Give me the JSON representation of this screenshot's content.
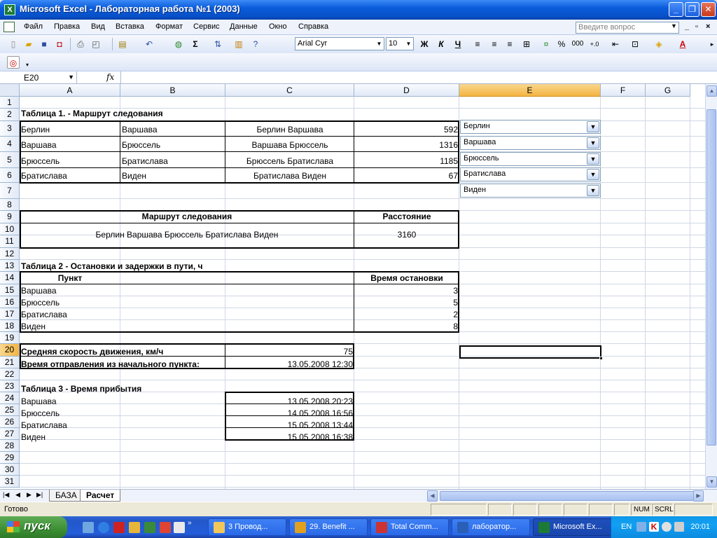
{
  "window": {
    "title": "Microsoft Excel - Лабораторная работа №1 (2003)"
  },
  "menu": {
    "items": [
      "Файл",
      "Правка",
      "Вид",
      "Вставка",
      "Формат",
      "Сервис",
      "Данные",
      "Окно",
      "Справка"
    ],
    "ask_placeholder": "Введите вопрос"
  },
  "toolbar": {
    "font": "Arial Cyr",
    "size": "10",
    "bold": "Ж",
    "italic": "К",
    "underline": "Ч",
    "percent": "%",
    "thousands": "000"
  },
  "formula_bar": {
    "name_box": "E20",
    "fx": "fx",
    "value": ""
  },
  "columns": [
    "A",
    "B",
    "C",
    "D",
    "E",
    "F",
    "G"
  ],
  "rows": [
    "1",
    "2",
    "3",
    "4",
    "5",
    "6",
    "7",
    "8",
    "9",
    "10",
    "11",
    "12",
    "13",
    "14",
    "15",
    "16",
    "17",
    "18",
    "19",
    "20",
    "21",
    "22",
    "23",
    "24",
    "25",
    "26",
    "27",
    "28",
    "29",
    "30",
    "31"
  ],
  "table1": {
    "title": "Таблица 1. - Маршрут следования",
    "rows": [
      {
        "a": "Берлин",
        "b": "Варшава",
        "c": "Берлин Варшава",
        "d": "592"
      },
      {
        "a": "Варшава",
        "b": "Брюссель",
        "c": "Варшава Брюссель",
        "d": "1316"
      },
      {
        "a": "Брюссель",
        "b": "Братислава",
        "c": "Брюссель Братислава",
        "d": "1185"
      },
      {
        "a": "Братислава",
        "b": "Виден",
        "c": "Братислава Виден",
        "d": "67"
      }
    ]
  },
  "combos": [
    "Берлин",
    "Варшава",
    "Брюссель",
    "Братислава",
    "Виден"
  ],
  "route": {
    "route_header": "Маршрут следования",
    "distance_header": "Расстояние",
    "route_value": "Берлин Варшава Брюссель Братислава Виден",
    "distance_value": "3160"
  },
  "table2": {
    "title": "Таблица 2 - Остановки и задержки в пути, ч",
    "point_header": "Пункт",
    "time_header": "Время остановки",
    "rows": [
      {
        "point": "Варшава",
        "time": "3"
      },
      {
        "point": "Брюссель",
        "time": "5"
      },
      {
        "point": "Братислава",
        "time": "2"
      },
      {
        "point": "Виден",
        "time": "8"
      }
    ]
  },
  "params": {
    "speed_label": "Средняя скорость движения, км/ч",
    "speed_value": "75",
    "departure_label": "Время отправления из начального пункта:",
    "departure_value": "13.05.2008 12:30"
  },
  "table3": {
    "title": "Таблица 3 - Время прибытия",
    "rows": [
      {
        "point": "Варшава",
        "time": "13.05.2008 20:23"
      },
      {
        "point": "Брюссель",
        "time": "14.05.2008 16:56"
      },
      {
        "point": "Братислава",
        "time": "15.05.2008 13:44"
      },
      {
        "point": "Виден",
        "time": "15.05.2008 16:38"
      }
    ]
  },
  "tabs": [
    "БАЗА",
    "Расчет"
  ],
  "status": {
    "left": "Готово",
    "num": "NUM",
    "scrl": "SCRL"
  },
  "taskbar": {
    "start": "пуск",
    "tasks": [
      "3 Провод...",
      "29. Benefit ...",
      "Total Comm...",
      "лаборатор...",
      "Microsoft Ex..."
    ],
    "lang": "EN",
    "clock": "20:01"
  },
  "colors": {
    "selection": "#f4b443",
    "title_blue": "#0a5cdb",
    "start_green": "#3c8f34"
  }
}
